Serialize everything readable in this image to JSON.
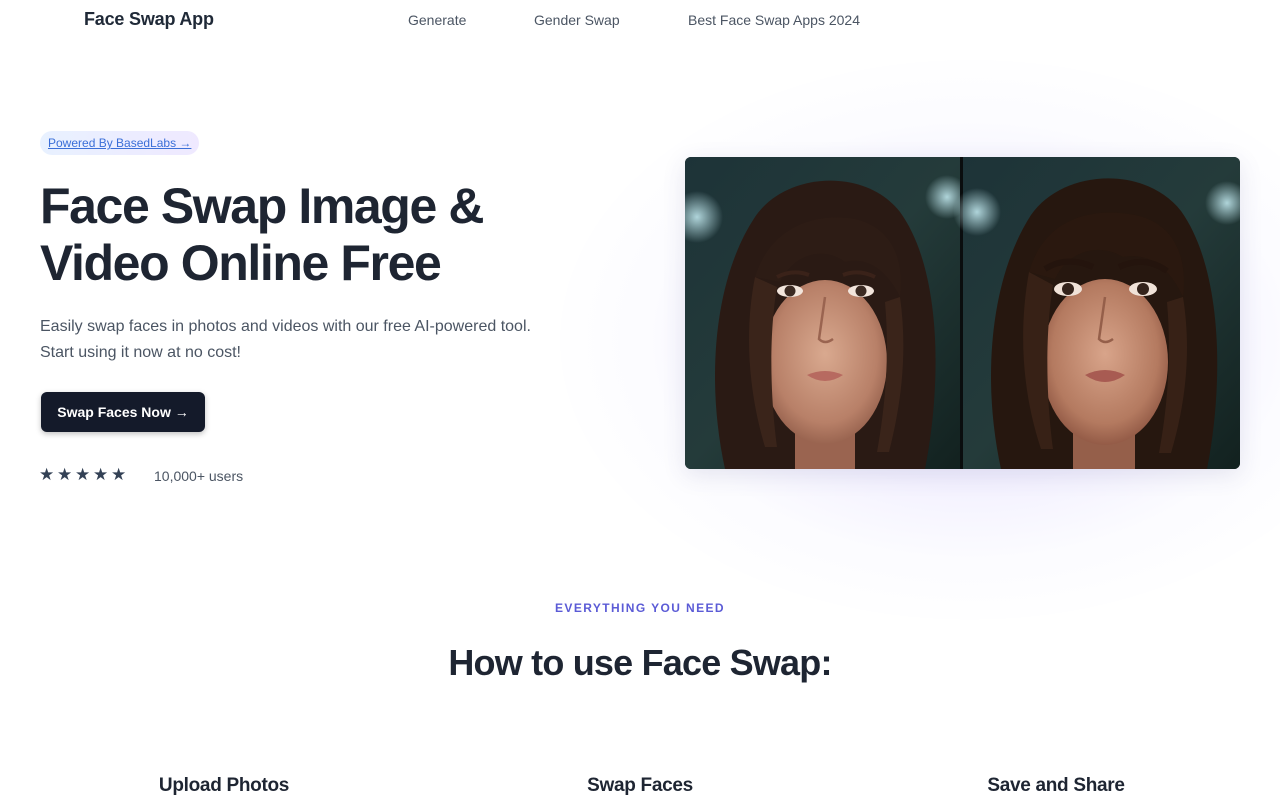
{
  "header": {
    "brand": "Face Swap App",
    "nav": [
      "Generate",
      "Gender Swap",
      "Best Face Swap Apps 2024"
    ]
  },
  "hero": {
    "badge": "Powered By BasedLabs →",
    "title_lines": [
      "Face Swap Image &",
      "Video Online Free"
    ],
    "subtitle_lines": [
      "Easily swap faces in photos and videos with our free AI-powered tool.",
      "Start using it now at no cost!"
    ],
    "cta": "Swap Faces Now →",
    "rating_stars": 5,
    "star_glyph": "★",
    "users": "10,000+ users"
  },
  "how_to": {
    "eyebrow": "EVERYTHING YOU NEED",
    "title": "How to use Face Swap:",
    "steps": [
      "Upload Photos",
      "Swap Faces",
      "Save and Share"
    ]
  },
  "colors": {
    "text_dark": "#1e2532",
    "cta_bg": "#141a2a",
    "accent": "#5b5bd6",
    "badge_text": "#3b6fd8"
  }
}
